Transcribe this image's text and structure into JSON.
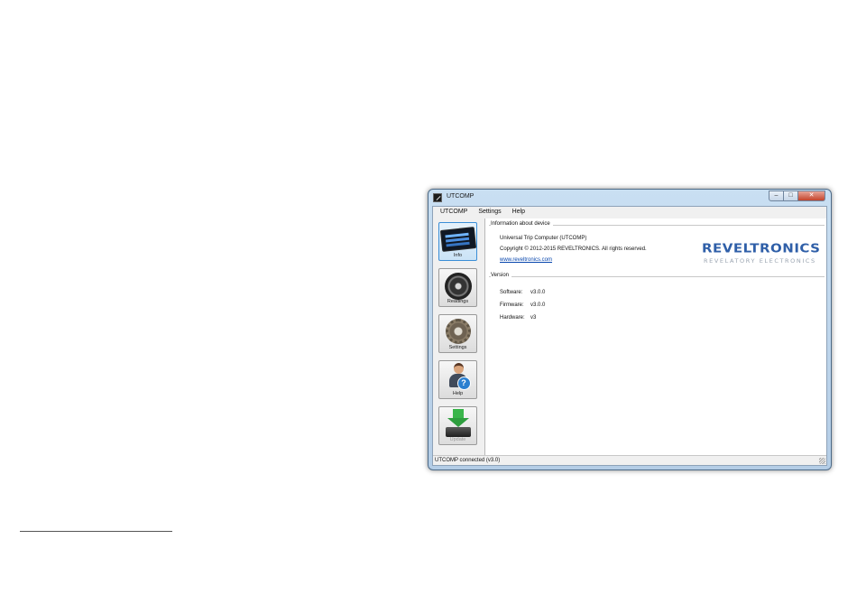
{
  "window": {
    "title": "UTCOMP",
    "controls": {
      "minimize": "–",
      "maximize": "□",
      "close": "✕"
    }
  },
  "menu": {
    "items": [
      {
        "label": "UTCOMP"
      },
      {
        "label": "Settings"
      },
      {
        "label": "Help"
      }
    ]
  },
  "nav": {
    "buttons": [
      {
        "label": "Info",
        "icon": "device-screen-icon",
        "active": true
      },
      {
        "label": "Readings",
        "icon": "gauge-icon"
      },
      {
        "label": "Settings",
        "icon": "gear-icon"
      },
      {
        "label": "Help",
        "icon": "user-help-icon"
      },
      {
        "label": "Update",
        "icon": "download-icon",
        "disabled": true
      }
    ]
  },
  "info": {
    "group_title": "Information about device",
    "product": "Universal Trip Computer (UTCOMP)",
    "copyright": "Copyright © 2012-2015 REVELTRONICS. All rights reserved.",
    "website": "www.reveltronics.com",
    "logo_main": "REVELTRONICS",
    "logo_sub": "REVELATORY ELECTRONICS"
  },
  "version": {
    "group_title": "Version",
    "software_label": "Software:",
    "software_value": "v3.0.0",
    "firmware_label": "Firmware:",
    "firmware_value": "v3.0.0",
    "hardware_label": "Hardware:",
    "hardware_value": "v3"
  },
  "status": {
    "text": "UTCOMP connected (v3.0)"
  },
  "colors": {
    "accent": "#3b8ed6",
    "logo": "#2f5fa8",
    "close": "#c4432b"
  }
}
